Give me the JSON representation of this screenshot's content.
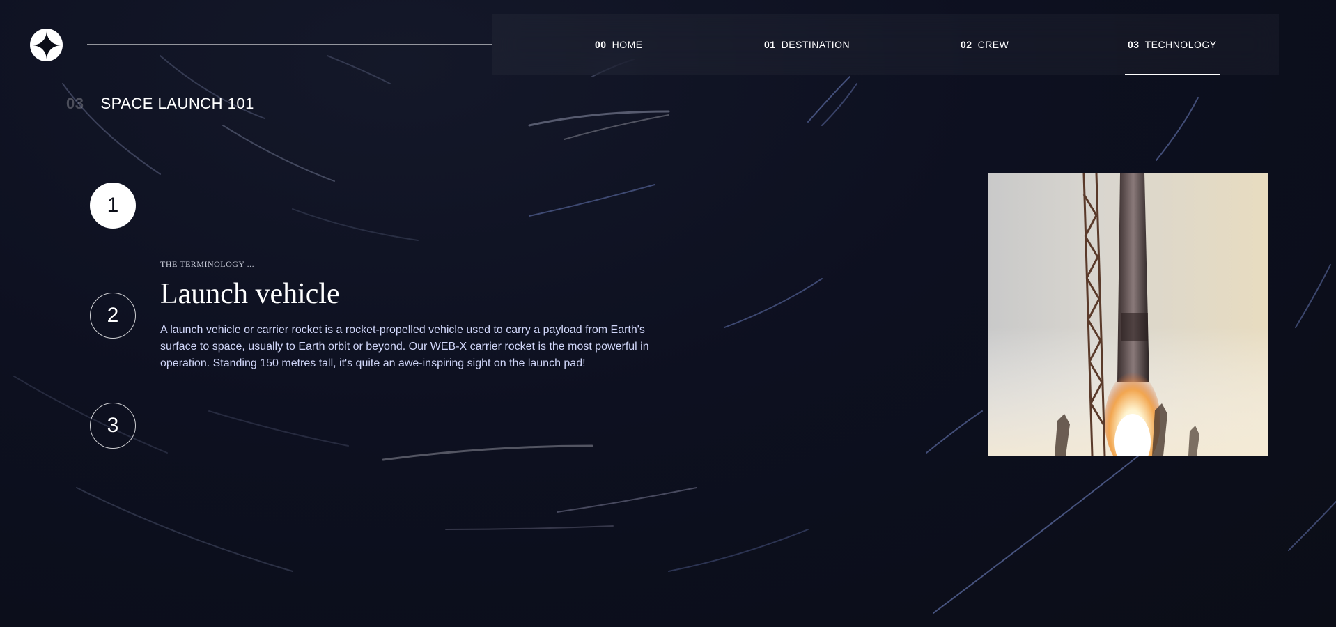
{
  "nav": {
    "items": [
      {
        "num": "00",
        "label": "HOME"
      },
      {
        "num": "01",
        "label": "DESTINATION"
      },
      {
        "num": "02",
        "label": "CREW"
      },
      {
        "num": "03",
        "label": "TECHNOLOGY"
      }
    ],
    "active_index": 3
  },
  "heading": {
    "num": "03",
    "title": "SPACE LAUNCH 101"
  },
  "steps": [
    "1",
    "2",
    "3"
  ],
  "active_step": 0,
  "technology": {
    "eyebrow": "THE TERMINOLOGY ...",
    "name": "Launch vehicle",
    "description": "A launch vehicle or carrier rocket is a rocket-propelled vehicle used to carry a payload from Earth's surface to space, usually to Earth orbit or beyond. Our WEB-X carrier rocket is the most powerful in operation. Standing 150 metres tall, it's quite an awe-inspiring sight on the launch pad!"
  },
  "icons": {
    "logo": "star-logo-icon"
  },
  "colors": {
    "background": "#0b0d17",
    "accent": "#ffffff",
    "muted_text": "#d0d6f9"
  }
}
